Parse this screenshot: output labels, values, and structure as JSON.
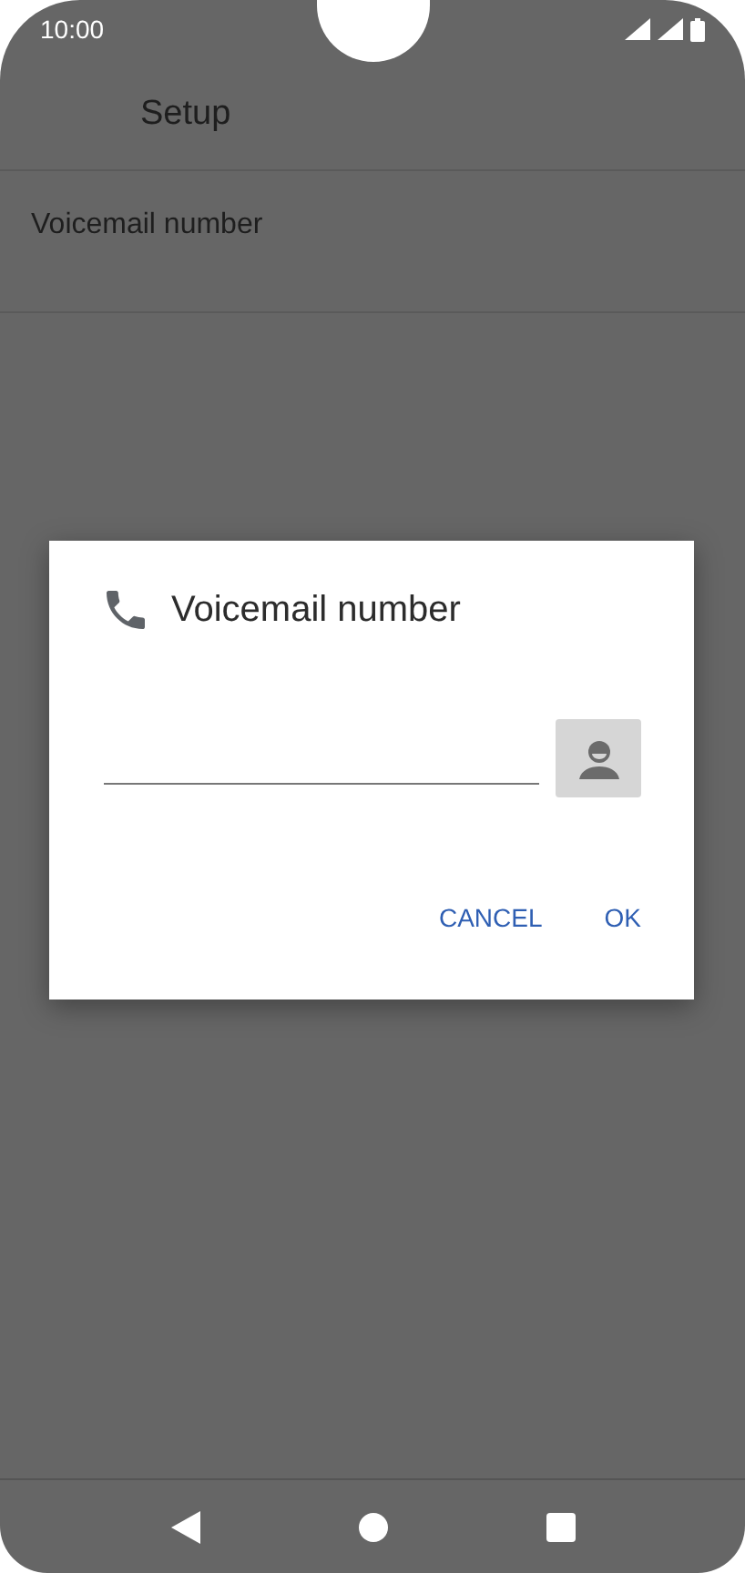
{
  "status_bar": {
    "time": "10:00"
  },
  "toolbar": {
    "title": "Setup"
  },
  "settings": [
    {
      "label": "Voicemail number"
    }
  ],
  "dialog": {
    "title": "Voicemail number",
    "buttons": [
      {
        "label": "CANCEL"
      },
      {
        "label": "OK"
      }
    ]
  }
}
